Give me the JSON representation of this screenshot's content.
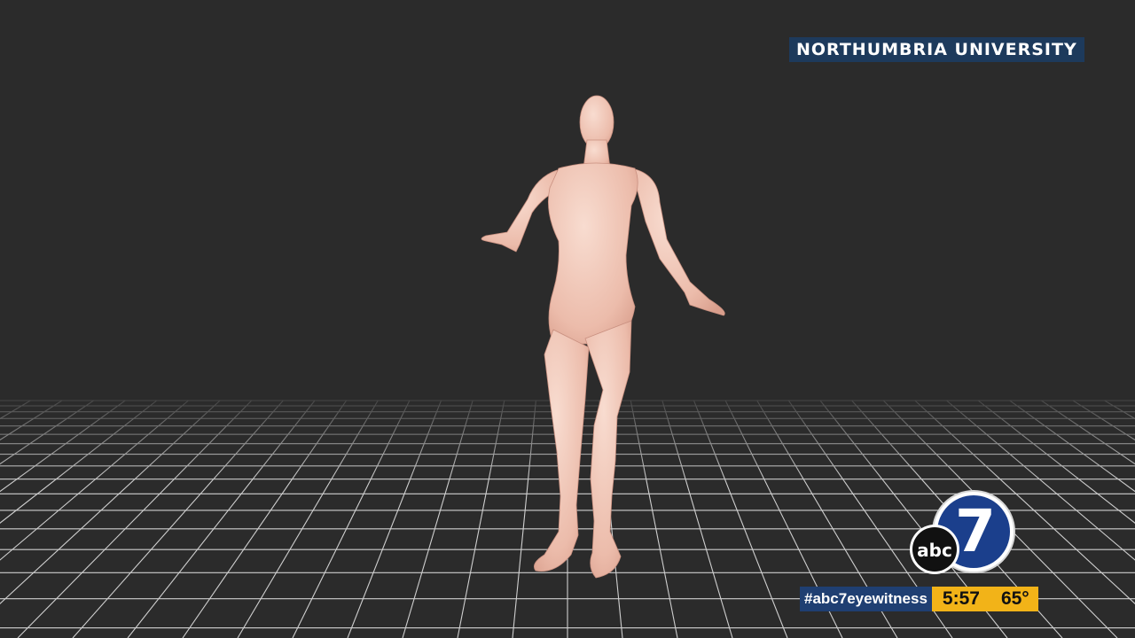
{
  "credit": {
    "text": "NORTHUMBRIA UNIVERSITY"
  },
  "logo": {
    "network_text": "abc",
    "channel_number": "7"
  },
  "lower_third": {
    "hashtag": "#abc7eyewitness",
    "time": "5:57",
    "temperature": "65°"
  },
  "colors": {
    "background": "#2b2b2b",
    "floor_grid": "#cfcfcf",
    "figure_skin": "#f1c9bb",
    "credit_bg": "#1d3a5c",
    "hashtag_bg": "#1f3f72",
    "time_bg": "#f2b318"
  }
}
